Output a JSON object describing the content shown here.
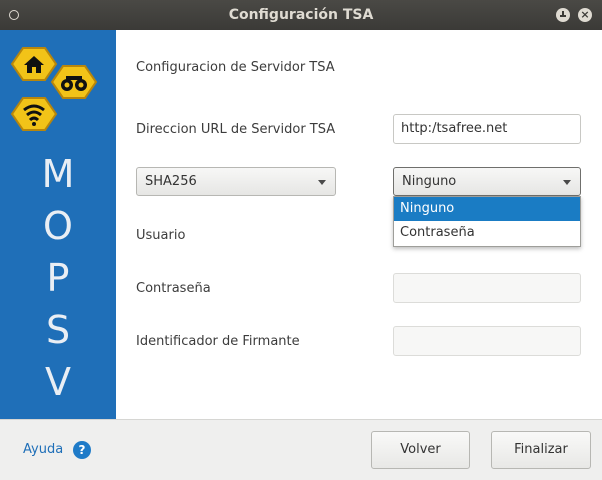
{
  "window": {
    "title": "Configuración TSA"
  },
  "sidebar": {
    "letters": [
      "M",
      "O",
      "P",
      "S",
      "V"
    ]
  },
  "form": {
    "heading": "Configuracion de Servidor TSA",
    "url_label": "Direccion URL de Servidor TSA",
    "url_value": "http:/tsafree.net",
    "algorithm_value": "SHA256",
    "auth_value": "Ninguno",
    "auth_options": [
      "Ninguno",
      "Contraseña"
    ],
    "auth_selected_index": 0,
    "user_label": "Usuario",
    "user_value": "",
    "password_label": "Contraseña",
    "password_value": "",
    "signer_label": "Identificador de Firmante",
    "signer_value": ""
  },
  "footer": {
    "help_label": "Ayuda",
    "help_icon_glyph": "?",
    "back_label": "Volver",
    "finish_label": "Finalizar"
  },
  "colors": {
    "sidebar_blue": "#1f6fb8",
    "selection_blue": "#1a7cc4",
    "hex_yellow": "#f2c318",
    "titlebar": "#3c3b37"
  }
}
